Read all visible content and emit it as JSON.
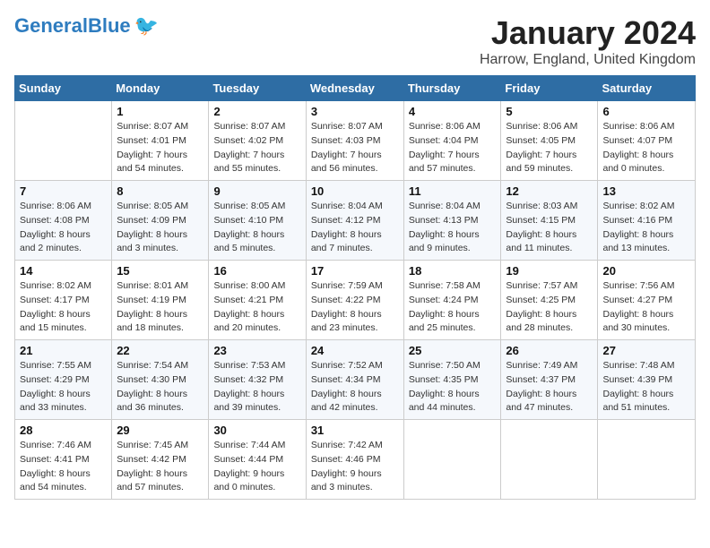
{
  "header": {
    "logo_general": "General",
    "logo_blue": "Blue",
    "month_title": "January 2024",
    "location": "Harrow, England, United Kingdom"
  },
  "weekdays": [
    "Sunday",
    "Monday",
    "Tuesday",
    "Wednesday",
    "Thursday",
    "Friday",
    "Saturday"
  ],
  "weeks": [
    [
      {
        "day": "",
        "info": ""
      },
      {
        "day": "1",
        "info": "Sunrise: 8:07 AM\nSunset: 4:01 PM\nDaylight: 7 hours\nand 54 minutes."
      },
      {
        "day": "2",
        "info": "Sunrise: 8:07 AM\nSunset: 4:02 PM\nDaylight: 7 hours\nand 55 minutes."
      },
      {
        "day": "3",
        "info": "Sunrise: 8:07 AM\nSunset: 4:03 PM\nDaylight: 7 hours\nand 56 minutes."
      },
      {
        "day": "4",
        "info": "Sunrise: 8:06 AM\nSunset: 4:04 PM\nDaylight: 7 hours\nand 57 minutes."
      },
      {
        "day": "5",
        "info": "Sunrise: 8:06 AM\nSunset: 4:05 PM\nDaylight: 7 hours\nand 59 minutes."
      },
      {
        "day": "6",
        "info": "Sunrise: 8:06 AM\nSunset: 4:07 PM\nDaylight: 8 hours\nand 0 minutes."
      }
    ],
    [
      {
        "day": "7",
        "info": "Sunrise: 8:06 AM\nSunset: 4:08 PM\nDaylight: 8 hours\nand 2 minutes."
      },
      {
        "day": "8",
        "info": "Sunrise: 8:05 AM\nSunset: 4:09 PM\nDaylight: 8 hours\nand 3 minutes."
      },
      {
        "day": "9",
        "info": "Sunrise: 8:05 AM\nSunset: 4:10 PM\nDaylight: 8 hours\nand 5 minutes."
      },
      {
        "day": "10",
        "info": "Sunrise: 8:04 AM\nSunset: 4:12 PM\nDaylight: 8 hours\nand 7 minutes."
      },
      {
        "day": "11",
        "info": "Sunrise: 8:04 AM\nSunset: 4:13 PM\nDaylight: 8 hours\nand 9 minutes."
      },
      {
        "day": "12",
        "info": "Sunrise: 8:03 AM\nSunset: 4:15 PM\nDaylight: 8 hours\nand 11 minutes."
      },
      {
        "day": "13",
        "info": "Sunrise: 8:02 AM\nSunset: 4:16 PM\nDaylight: 8 hours\nand 13 minutes."
      }
    ],
    [
      {
        "day": "14",
        "info": "Sunrise: 8:02 AM\nSunset: 4:17 PM\nDaylight: 8 hours\nand 15 minutes."
      },
      {
        "day": "15",
        "info": "Sunrise: 8:01 AM\nSunset: 4:19 PM\nDaylight: 8 hours\nand 18 minutes."
      },
      {
        "day": "16",
        "info": "Sunrise: 8:00 AM\nSunset: 4:21 PM\nDaylight: 8 hours\nand 20 minutes."
      },
      {
        "day": "17",
        "info": "Sunrise: 7:59 AM\nSunset: 4:22 PM\nDaylight: 8 hours\nand 23 minutes."
      },
      {
        "day": "18",
        "info": "Sunrise: 7:58 AM\nSunset: 4:24 PM\nDaylight: 8 hours\nand 25 minutes."
      },
      {
        "day": "19",
        "info": "Sunrise: 7:57 AM\nSunset: 4:25 PM\nDaylight: 8 hours\nand 28 minutes."
      },
      {
        "day": "20",
        "info": "Sunrise: 7:56 AM\nSunset: 4:27 PM\nDaylight: 8 hours\nand 30 minutes."
      }
    ],
    [
      {
        "day": "21",
        "info": "Sunrise: 7:55 AM\nSunset: 4:29 PM\nDaylight: 8 hours\nand 33 minutes."
      },
      {
        "day": "22",
        "info": "Sunrise: 7:54 AM\nSunset: 4:30 PM\nDaylight: 8 hours\nand 36 minutes."
      },
      {
        "day": "23",
        "info": "Sunrise: 7:53 AM\nSunset: 4:32 PM\nDaylight: 8 hours\nand 39 minutes."
      },
      {
        "day": "24",
        "info": "Sunrise: 7:52 AM\nSunset: 4:34 PM\nDaylight: 8 hours\nand 42 minutes."
      },
      {
        "day": "25",
        "info": "Sunrise: 7:50 AM\nSunset: 4:35 PM\nDaylight: 8 hours\nand 44 minutes."
      },
      {
        "day": "26",
        "info": "Sunrise: 7:49 AM\nSunset: 4:37 PM\nDaylight: 8 hours\nand 47 minutes."
      },
      {
        "day": "27",
        "info": "Sunrise: 7:48 AM\nSunset: 4:39 PM\nDaylight: 8 hours\nand 51 minutes."
      }
    ],
    [
      {
        "day": "28",
        "info": "Sunrise: 7:46 AM\nSunset: 4:41 PM\nDaylight: 8 hours\nand 54 minutes."
      },
      {
        "day": "29",
        "info": "Sunrise: 7:45 AM\nSunset: 4:42 PM\nDaylight: 8 hours\nand 57 minutes."
      },
      {
        "day": "30",
        "info": "Sunrise: 7:44 AM\nSunset: 4:44 PM\nDaylight: 9 hours\nand 0 minutes."
      },
      {
        "day": "31",
        "info": "Sunrise: 7:42 AM\nSunset: 4:46 PM\nDaylight: 9 hours\nand 3 minutes."
      },
      {
        "day": "",
        "info": ""
      },
      {
        "day": "",
        "info": ""
      },
      {
        "day": "",
        "info": ""
      }
    ]
  ]
}
